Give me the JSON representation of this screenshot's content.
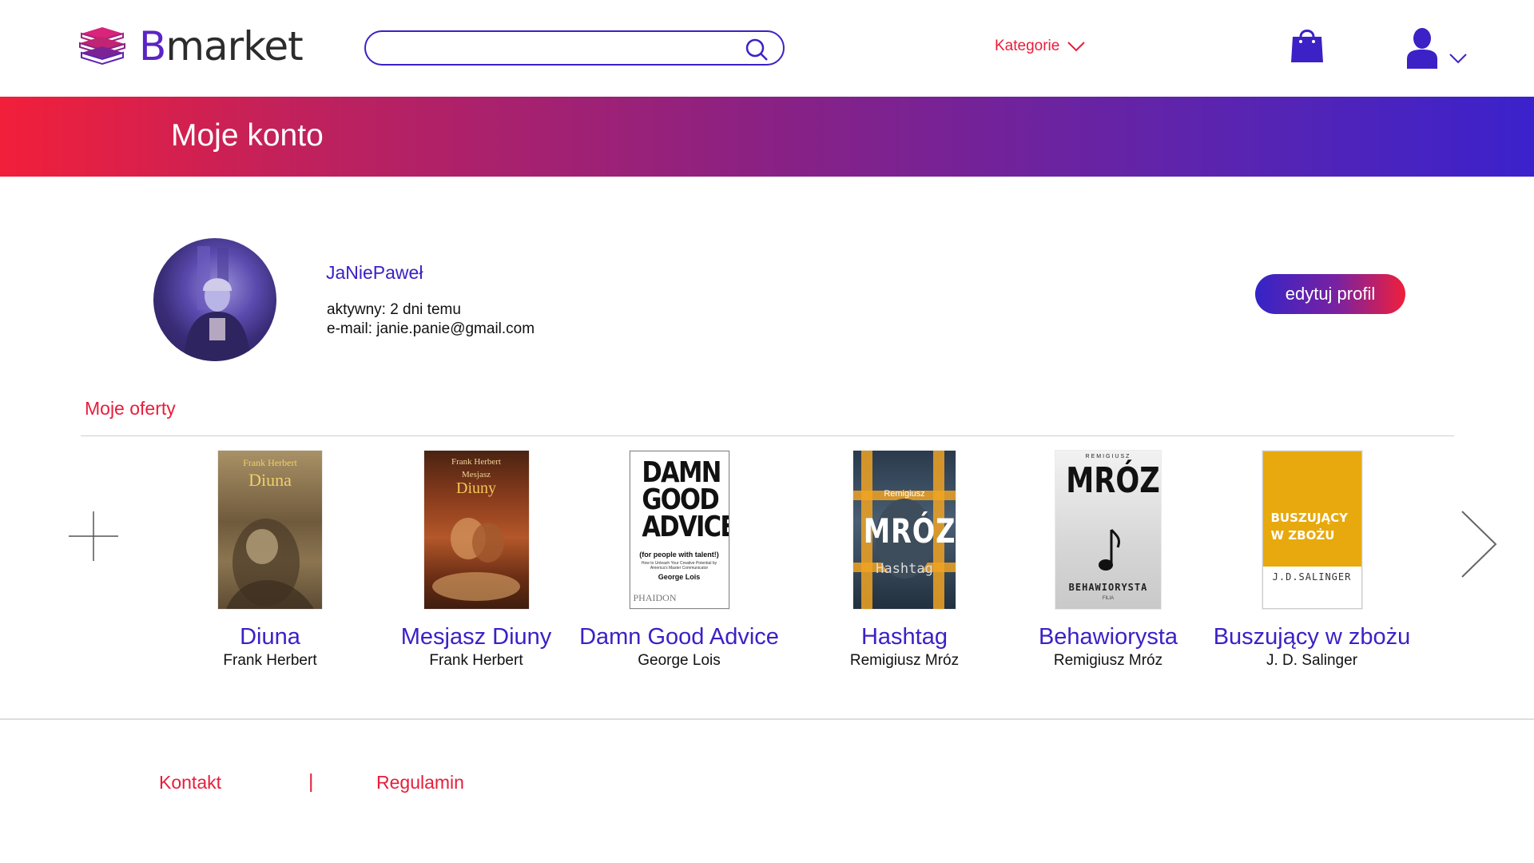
{
  "header": {
    "logo_first": "B",
    "logo_rest": "market",
    "search": {
      "value": "",
      "placeholder": ""
    },
    "categories_label": "Kategorie",
    "icons": {
      "search": "search-icon",
      "cart": "shopping-bag-icon",
      "user": "user-icon",
      "dropdown": "chevron-down-icon"
    }
  },
  "banner": {
    "title": "Moje konto"
  },
  "profile": {
    "username": "JaNiePaweł",
    "active": "aktywny: 2 dni temu",
    "email": "e-mail: janie.panie@gmail.com",
    "edit_label": "edytuj profil"
  },
  "offers": {
    "title": "Moje oferty",
    "books": [
      {
        "title": "Diuna",
        "author": "Frank Herbert",
        "cover": {
          "top": "Frank Herbert",
          "main": "Diuna"
        }
      },
      {
        "title": "Mesjasz Diuny",
        "author": "Frank Herbert",
        "cover": {
          "top": "Frank Herbert",
          "sub": "Mesjasz",
          "main": "Diuny"
        }
      },
      {
        "title": "Damn Good Advice",
        "author": "George Lois",
        "cover": {
          "main": "DAMN GOOD ADVICE",
          "sub": "(for people with talent!)",
          "small": "How to Unleash Your Creative Potential by America's Master Communicator",
          "author": "George Lois",
          "publisher": "PHAIDON"
        }
      },
      {
        "title": "Hashtag",
        "author": "Remigiusz Mróz",
        "cover": {
          "top": "Remigiusz",
          "main": "MRÓZ",
          "sub": "Hashtag"
        }
      },
      {
        "title": "Behawiorysta",
        "author": "Remigiusz Mróz",
        "cover": {
          "top": "REMIGIUSZ",
          "main": "MRÓZ",
          "sub": "BEHAWIORYSTA",
          "publisher": "FILIA"
        }
      },
      {
        "title": "Buszujący w zbożu",
        "author": "J. D. Salinger",
        "cover": {
          "main": "BUSZUJĄCY W ZBOŻU",
          "author": "J.D.SALINGER"
        }
      }
    ]
  },
  "footer": {
    "contact": "Kontakt",
    "separator": "|",
    "terms": "Regulamin"
  },
  "colors": {
    "accent_red": "#e81d3b",
    "accent_blue": "#3b21c6"
  }
}
